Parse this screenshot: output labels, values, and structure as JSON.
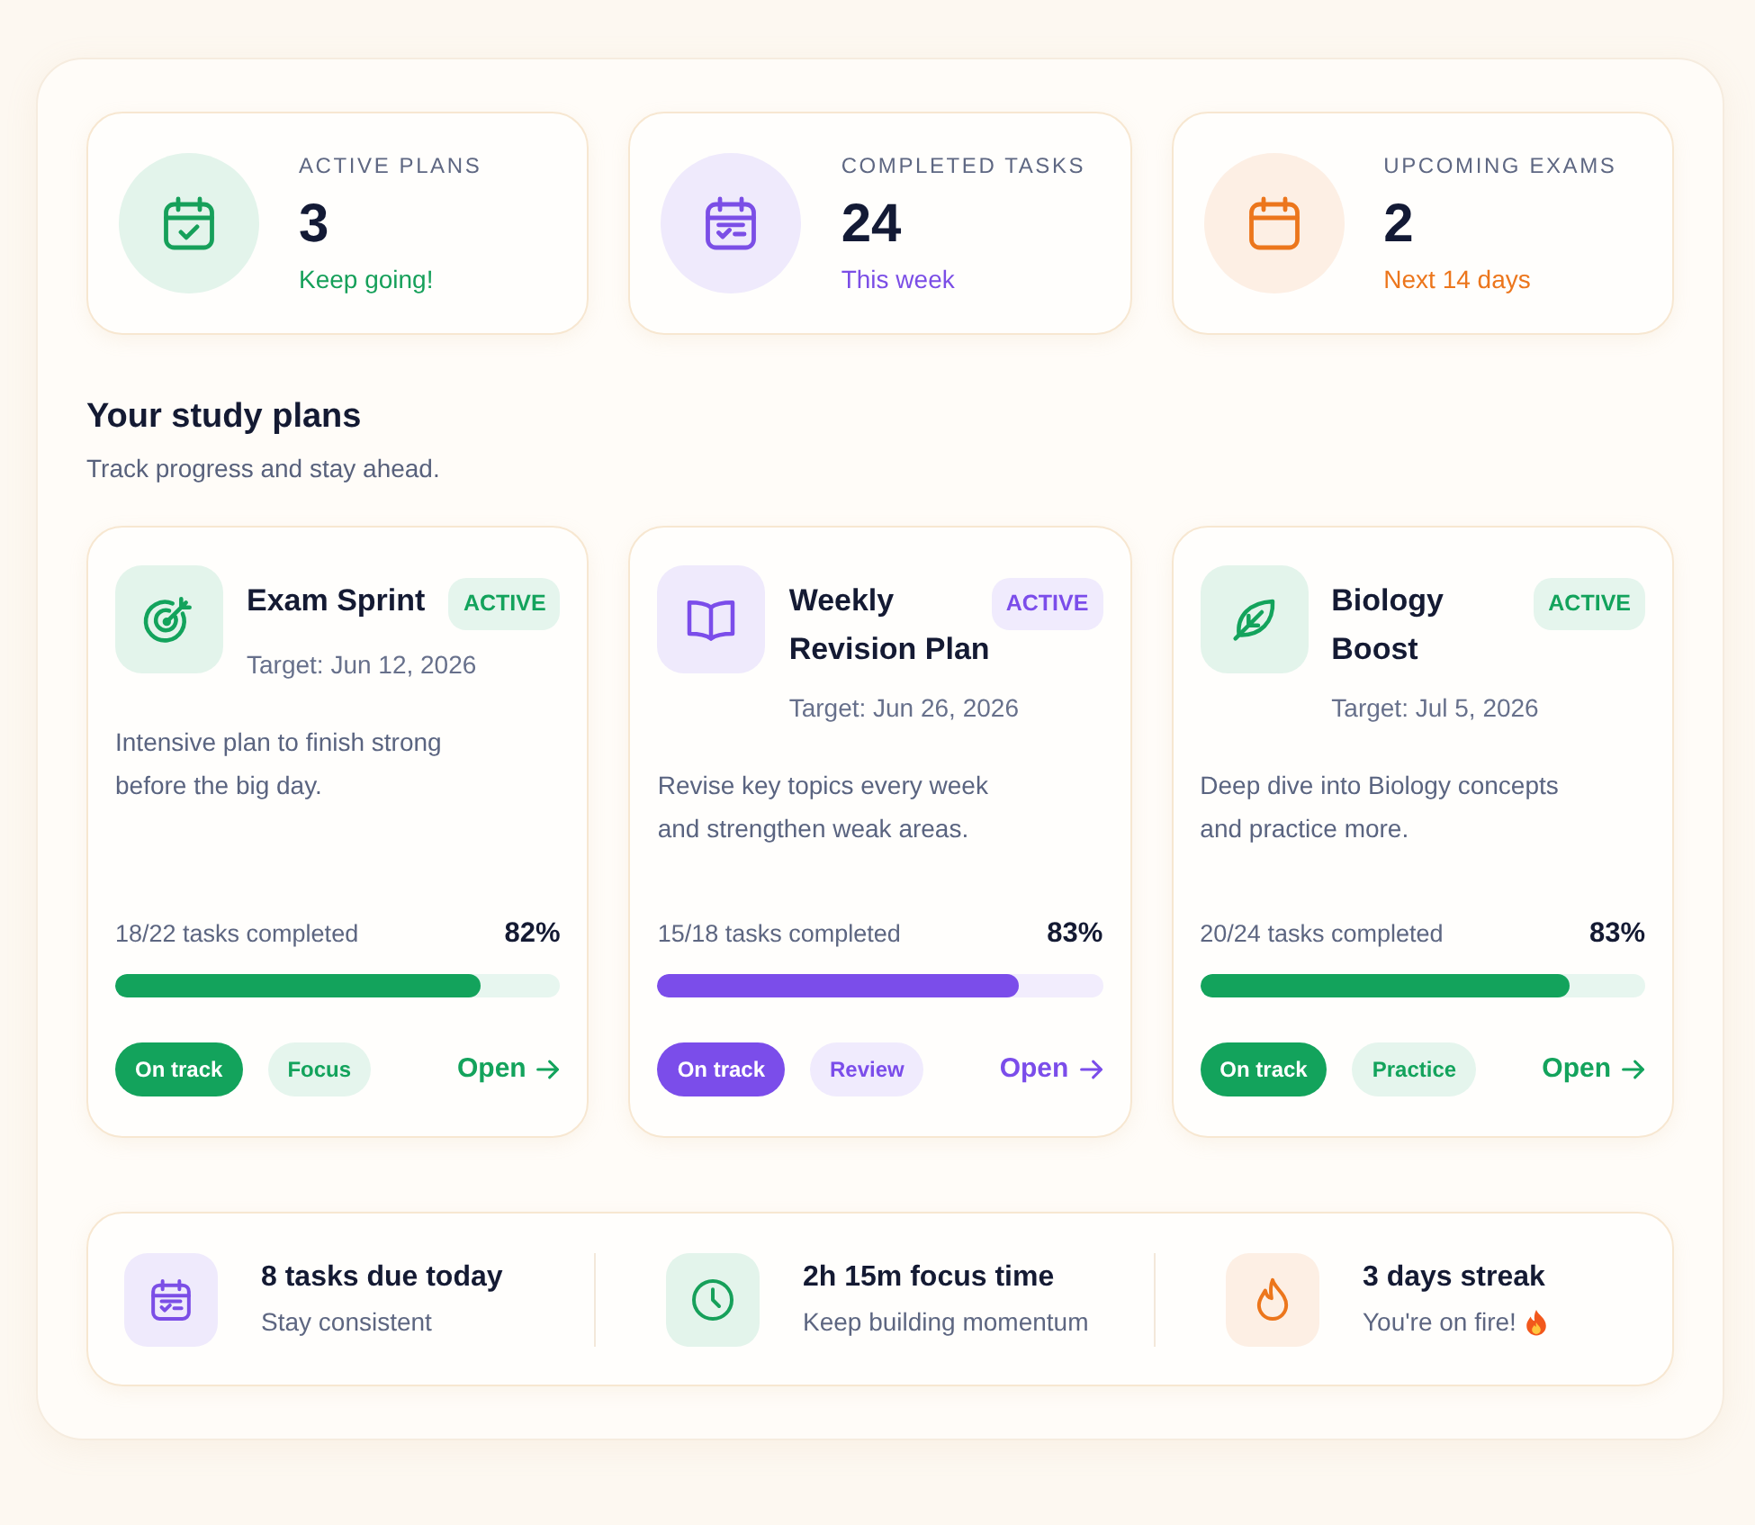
{
  "stats": [
    {
      "label": "ACTIVE PLANS",
      "value": "3",
      "note": "Keep going!",
      "color": "#16a05a"
    },
    {
      "label": "COMPLETED TASKS",
      "value": "24",
      "note": "This week",
      "color": "#7b4ee6"
    },
    {
      "label": "UPCOMING EXAMS",
      "value": "2",
      "note": "Next 14 days",
      "color": "#ec761c"
    }
  ],
  "section": {
    "title": "Your study plans",
    "subtitle": "Track progress and stay ahead."
  },
  "plans": [
    {
      "title": "Exam Sprint",
      "status": "ACTIVE",
      "target": "Target: Jun 12, 2026",
      "description": "Intensive plan to finish strong before the big day.",
      "progress_label": "18/22 tasks completed",
      "percent": "82%",
      "level": 0.82,
      "color": "#13a35c",
      "tags": [
        {
          "label": "On track",
          "kind": "filled"
        },
        {
          "label": "Focus",
          "kind": "soft"
        }
      ],
      "action": "Open"
    },
    {
      "title": "Weekly Revision Plan",
      "status": "ACTIVE",
      "target": "Target: Jun 26, 2026",
      "description": "Revise key topics every week and strengthen weak areas.",
      "progress_label": "15/18 tasks completed",
      "percent": "83%",
      "level": 0.81,
      "color": "#7b4dea",
      "tags": [
        {
          "label": "On track",
          "kind": "filled"
        },
        {
          "label": "Review",
          "kind": "soft"
        }
      ],
      "action": "Open"
    },
    {
      "title": "Biology Boost",
      "status": "ACTIVE",
      "target": "Target: Jul 5, 2026",
      "description": "Deep dive into Biology concepts and practice more.",
      "progress_label": "20/24 tasks completed",
      "percent": "83%",
      "level": 0.83,
      "color": "#13a35c",
      "tags": [
        {
          "label": "On track",
          "kind": "filled"
        },
        {
          "label": "Practice",
          "kind": "soft"
        }
      ],
      "action": "Open"
    }
  ],
  "summary": [
    {
      "title": "8 tasks due today",
      "subtitle": "Stay consistent",
      "color": "#7b4ee6"
    },
    {
      "title": "2h 15m focus time",
      "subtitle": "Keep building momentum",
      "color": "#16a05a"
    },
    {
      "title": "3 days streak",
      "subtitle": "You're on fire!",
      "color": "#ec761c"
    }
  ]
}
